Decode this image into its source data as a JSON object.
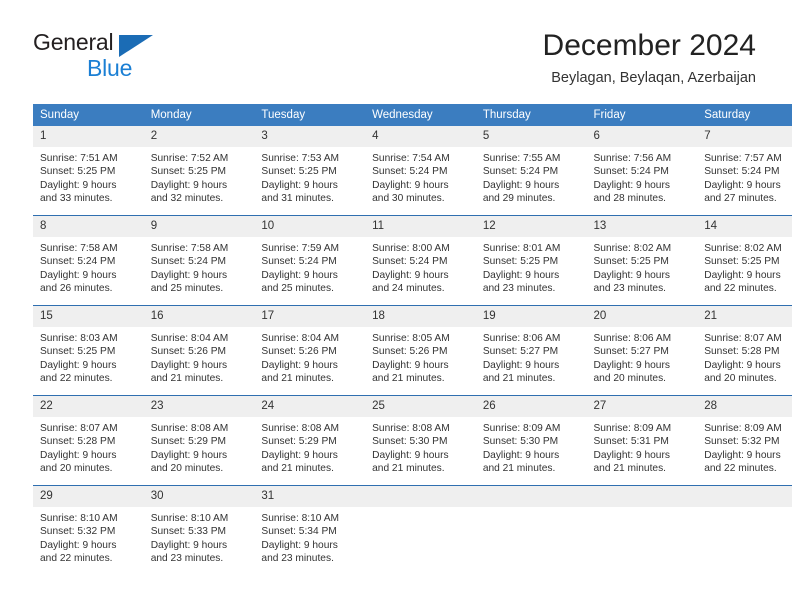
{
  "brand": {
    "line1": "General",
    "line2": "Blue",
    "mark": "triangle-logo"
  },
  "header": {
    "title": "December 2024",
    "subtitle": "Beylagan, Beylaqan, Azerbaijan"
  },
  "colors": {
    "header_blue": "#3b7dc0",
    "row_divider_blue": "#2f6fb0",
    "daynum_gray": "#efefef",
    "brand_blue": "#1b7fd4",
    "brand_mark_blue": "#1b6cb5",
    "text": "#333333"
  },
  "weekdays": [
    "Sunday",
    "Monday",
    "Tuesday",
    "Wednesday",
    "Thursday",
    "Friday",
    "Saturday"
  ],
  "weeks": [
    [
      {
        "day": "1",
        "sunrise": "Sunrise: 7:51 AM",
        "sunset": "Sunset: 5:25 PM",
        "daylight1": "Daylight: 9 hours",
        "daylight2": "and 33 minutes."
      },
      {
        "day": "2",
        "sunrise": "Sunrise: 7:52 AM",
        "sunset": "Sunset: 5:25 PM",
        "daylight1": "Daylight: 9 hours",
        "daylight2": "and 32 minutes."
      },
      {
        "day": "3",
        "sunrise": "Sunrise: 7:53 AM",
        "sunset": "Sunset: 5:25 PM",
        "daylight1": "Daylight: 9 hours",
        "daylight2": "and 31 minutes."
      },
      {
        "day": "4",
        "sunrise": "Sunrise: 7:54 AM",
        "sunset": "Sunset: 5:24 PM",
        "daylight1": "Daylight: 9 hours",
        "daylight2": "and 30 minutes."
      },
      {
        "day": "5",
        "sunrise": "Sunrise: 7:55 AM",
        "sunset": "Sunset: 5:24 PM",
        "daylight1": "Daylight: 9 hours",
        "daylight2": "and 29 minutes."
      },
      {
        "day": "6",
        "sunrise": "Sunrise: 7:56 AM",
        "sunset": "Sunset: 5:24 PM",
        "daylight1": "Daylight: 9 hours",
        "daylight2": "and 28 minutes."
      },
      {
        "day": "7",
        "sunrise": "Sunrise: 7:57 AM",
        "sunset": "Sunset: 5:24 PM",
        "daylight1": "Daylight: 9 hours",
        "daylight2": "and 27 minutes."
      }
    ],
    [
      {
        "day": "8",
        "sunrise": "Sunrise: 7:58 AM",
        "sunset": "Sunset: 5:24 PM",
        "daylight1": "Daylight: 9 hours",
        "daylight2": "and 26 minutes."
      },
      {
        "day": "9",
        "sunrise": "Sunrise: 7:58 AM",
        "sunset": "Sunset: 5:24 PM",
        "daylight1": "Daylight: 9 hours",
        "daylight2": "and 25 minutes."
      },
      {
        "day": "10",
        "sunrise": "Sunrise: 7:59 AM",
        "sunset": "Sunset: 5:24 PM",
        "daylight1": "Daylight: 9 hours",
        "daylight2": "and 25 minutes."
      },
      {
        "day": "11",
        "sunrise": "Sunrise: 8:00 AM",
        "sunset": "Sunset: 5:24 PM",
        "daylight1": "Daylight: 9 hours",
        "daylight2": "and 24 minutes."
      },
      {
        "day": "12",
        "sunrise": "Sunrise: 8:01 AM",
        "sunset": "Sunset: 5:25 PM",
        "daylight1": "Daylight: 9 hours",
        "daylight2": "and 23 minutes."
      },
      {
        "day": "13",
        "sunrise": "Sunrise: 8:02 AM",
        "sunset": "Sunset: 5:25 PM",
        "daylight1": "Daylight: 9 hours",
        "daylight2": "and 23 minutes."
      },
      {
        "day": "14",
        "sunrise": "Sunrise: 8:02 AM",
        "sunset": "Sunset: 5:25 PM",
        "daylight1": "Daylight: 9 hours",
        "daylight2": "and 22 minutes."
      }
    ],
    [
      {
        "day": "15",
        "sunrise": "Sunrise: 8:03 AM",
        "sunset": "Sunset: 5:25 PM",
        "daylight1": "Daylight: 9 hours",
        "daylight2": "and 22 minutes."
      },
      {
        "day": "16",
        "sunrise": "Sunrise: 8:04 AM",
        "sunset": "Sunset: 5:26 PM",
        "daylight1": "Daylight: 9 hours",
        "daylight2": "and 21 minutes."
      },
      {
        "day": "17",
        "sunrise": "Sunrise: 8:04 AM",
        "sunset": "Sunset: 5:26 PM",
        "daylight1": "Daylight: 9 hours",
        "daylight2": "and 21 minutes."
      },
      {
        "day": "18",
        "sunrise": "Sunrise: 8:05 AM",
        "sunset": "Sunset: 5:26 PM",
        "daylight1": "Daylight: 9 hours",
        "daylight2": "and 21 minutes."
      },
      {
        "day": "19",
        "sunrise": "Sunrise: 8:06 AM",
        "sunset": "Sunset: 5:27 PM",
        "daylight1": "Daylight: 9 hours",
        "daylight2": "and 21 minutes."
      },
      {
        "day": "20",
        "sunrise": "Sunrise: 8:06 AM",
        "sunset": "Sunset: 5:27 PM",
        "daylight1": "Daylight: 9 hours",
        "daylight2": "and 20 minutes."
      },
      {
        "day": "21",
        "sunrise": "Sunrise: 8:07 AM",
        "sunset": "Sunset: 5:28 PM",
        "daylight1": "Daylight: 9 hours",
        "daylight2": "and 20 minutes."
      }
    ],
    [
      {
        "day": "22",
        "sunrise": "Sunrise: 8:07 AM",
        "sunset": "Sunset: 5:28 PM",
        "daylight1": "Daylight: 9 hours",
        "daylight2": "and 20 minutes."
      },
      {
        "day": "23",
        "sunrise": "Sunrise: 8:08 AM",
        "sunset": "Sunset: 5:29 PM",
        "daylight1": "Daylight: 9 hours",
        "daylight2": "and 20 minutes."
      },
      {
        "day": "24",
        "sunrise": "Sunrise: 8:08 AM",
        "sunset": "Sunset: 5:29 PM",
        "daylight1": "Daylight: 9 hours",
        "daylight2": "and 21 minutes."
      },
      {
        "day": "25",
        "sunrise": "Sunrise: 8:08 AM",
        "sunset": "Sunset: 5:30 PM",
        "daylight1": "Daylight: 9 hours",
        "daylight2": "and 21 minutes."
      },
      {
        "day": "26",
        "sunrise": "Sunrise: 8:09 AM",
        "sunset": "Sunset: 5:30 PM",
        "daylight1": "Daylight: 9 hours",
        "daylight2": "and 21 minutes."
      },
      {
        "day": "27",
        "sunrise": "Sunrise: 8:09 AM",
        "sunset": "Sunset: 5:31 PM",
        "daylight1": "Daylight: 9 hours",
        "daylight2": "and 21 minutes."
      },
      {
        "day": "28",
        "sunrise": "Sunrise: 8:09 AM",
        "sunset": "Sunset: 5:32 PM",
        "daylight1": "Daylight: 9 hours",
        "daylight2": "and 22 minutes."
      }
    ],
    [
      {
        "day": "29",
        "sunrise": "Sunrise: 8:10 AM",
        "sunset": "Sunset: 5:32 PM",
        "daylight1": "Daylight: 9 hours",
        "daylight2": "and 22 minutes."
      },
      {
        "day": "30",
        "sunrise": "Sunrise: 8:10 AM",
        "sunset": "Sunset: 5:33 PM",
        "daylight1": "Daylight: 9 hours",
        "daylight2": "and 23 minutes."
      },
      {
        "day": "31",
        "sunrise": "Sunrise: 8:10 AM",
        "sunset": "Sunset: 5:34 PM",
        "daylight1": "Daylight: 9 hours",
        "daylight2": "and 23 minutes."
      },
      {
        "day": "",
        "sunrise": "",
        "sunset": "",
        "daylight1": "",
        "daylight2": ""
      },
      {
        "day": "",
        "sunrise": "",
        "sunset": "",
        "daylight1": "",
        "daylight2": ""
      },
      {
        "day": "",
        "sunrise": "",
        "sunset": "",
        "daylight1": "",
        "daylight2": ""
      },
      {
        "day": "",
        "sunrise": "",
        "sunset": "",
        "daylight1": "",
        "daylight2": ""
      }
    ]
  ]
}
